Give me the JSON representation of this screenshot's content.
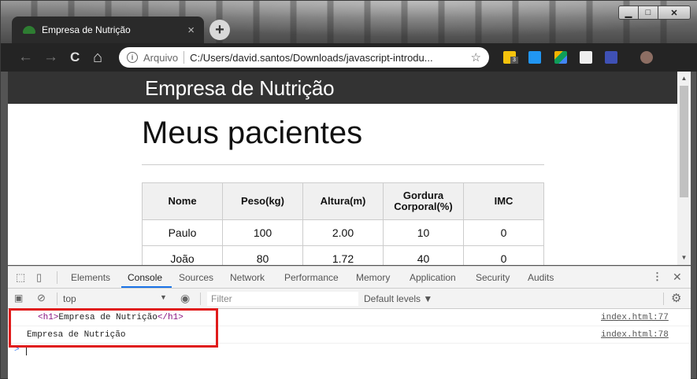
{
  "window": {
    "tab_title": "Empresa de Nutrição",
    "tab_close": "×",
    "new_tab": "+",
    "controls": {
      "minimize": "▁",
      "maximize": "□",
      "close": "✕"
    }
  },
  "toolbar": {
    "back_icon": "←",
    "forward_icon": "→",
    "reload_icon": "C",
    "home_icon": "⌂",
    "scheme_label": "Arquivo",
    "url": "C:/Users/david.santos/Downloads/javascript-introdu...",
    "star_icon": "☆",
    "extension_badge": "3",
    "menu_icon": "⋮"
  },
  "page": {
    "site_title": "Empresa de Nutrição",
    "heading": "Meus pacientes",
    "table": {
      "headers": [
        "Nome",
        "Peso(kg)",
        "Altura(m)",
        "Gordura Corporal(%)",
        "IMC"
      ],
      "rows": [
        [
          "Paulo",
          "100",
          "2.00",
          "10",
          "0"
        ],
        [
          "João",
          "80",
          "1.72",
          "40",
          "0"
        ]
      ]
    }
  },
  "devtools": {
    "tabs": [
      "Elements",
      "Console",
      "Sources",
      "Network",
      "Performance",
      "Memory",
      "Application",
      "Security",
      "Audits"
    ],
    "active_tab": "Console",
    "context": "top",
    "filter_placeholder": "Filter",
    "levels": "Default levels ▼",
    "console": [
      {
        "open_tag": "<h1>",
        "text": "Empresa de Nutrição",
        "close_tag": "</h1>",
        "source": "index.html:77"
      },
      {
        "text": "Empresa de Nutrição",
        "source": "index.html:78"
      }
    ],
    "prompt": ">"
  },
  "colors": {
    "site_header_bg": "#333333",
    "highlight_border": "#e01b1b",
    "devtools_active_tab": "#1a73e8",
    "tag_color": "#881280"
  }
}
